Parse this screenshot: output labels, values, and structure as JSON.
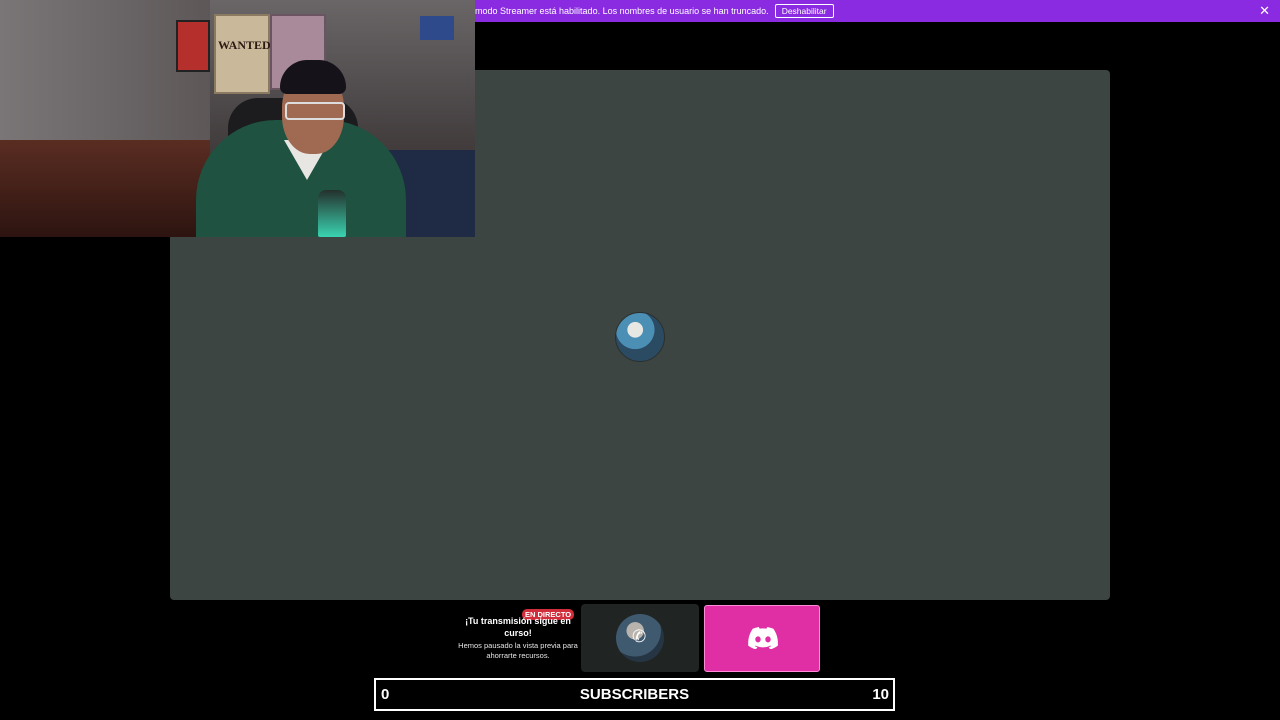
{
  "banner": {
    "message": "modo Streamer está habilitado. Los nombres de usuario se han truncado.",
    "disable_label": "Deshabilitar",
    "close_glyph": "✕",
    "color": "#8a2be2"
  },
  "webcam": {
    "poster_text": "WANTED!"
  },
  "stage": {
    "background": "#3d4542"
  },
  "live": {
    "badge": "EN DIRECTO",
    "title": "¡Tu transmisión sigue en curso!",
    "subtitle": "Hemos pausado la vista previa para ahorrarte recursos."
  },
  "call_tile": {
    "icon": "phone-icon"
  },
  "discord_tile": {
    "icon": "discord-icon",
    "color": "#e02fa4"
  },
  "subscribers": {
    "current": "0",
    "label": "SUBSCRIBERS",
    "goal": "10",
    "progress": 0
  }
}
